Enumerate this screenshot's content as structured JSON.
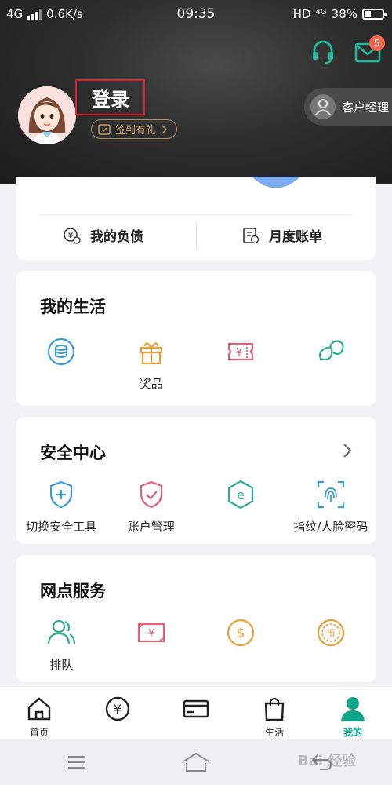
{
  "status_bar": {
    "network": "4G",
    "speed": "0.6K/s",
    "time": "09:35",
    "hd": "HD",
    "network_right": "4G",
    "battery": "38%",
    "battery_level": 0.38
  },
  "header": {
    "message_count": "5",
    "login_label": "登录",
    "signin_label": "签到有礼",
    "manager_label": "客户经理"
  },
  "finance_card": {
    "actions": [
      {
        "label": "我的负债",
        "icon": "debt-icon"
      },
      {
        "label": "月度账单",
        "icon": "bill-icon"
      }
    ]
  },
  "life": {
    "title": "我的生活",
    "items": [
      {
        "label": "",
        "icon": "coins-icon",
        "color": "#3a9bd9"
      },
      {
        "label": "奖品",
        "icon": "gift-icon",
        "color": "#e8a13a"
      },
      {
        "label": "",
        "icon": "ticket-icon",
        "color": "#e0607a"
      },
      {
        "label": "",
        "icon": "beans-icon",
        "color": "#2eae8f"
      }
    ]
  },
  "security": {
    "title": "安全中心",
    "items": [
      {
        "label": "切换安全工具",
        "icon": "shield-plus-icon",
        "color": "#3a9bd9"
      },
      {
        "label": "账户管理",
        "icon": "shield-check-icon",
        "color": "#e0607a"
      },
      {
        "label": "",
        "icon": "e-hexagon-icon",
        "color": "#2eae8f"
      },
      {
        "label": "指纹/人脸密码",
        "icon": "fingerprint-icon",
        "color": "#3a9bd9"
      }
    ]
  },
  "branch": {
    "title": "网点服务",
    "items": [
      {
        "label": "排队",
        "icon": "queue-icon",
        "color": "#2eae8f"
      },
      {
        "label": "",
        "icon": "cash-icon",
        "color": "#e0607a"
      },
      {
        "label": "",
        "icon": "coin-dollar-icon",
        "color": "#e8a13a"
      },
      {
        "label": "",
        "icon": "coin-bi-icon",
        "color": "#e8a13a"
      }
    ]
  },
  "tabs": [
    {
      "label": "首页",
      "icon": "home-icon"
    },
    {
      "label": "",
      "icon": "yen-icon"
    },
    {
      "label": "",
      "icon": "card-icon"
    },
    {
      "label": "生活",
      "icon": "shopping-bag-icon"
    },
    {
      "label": "我的",
      "icon": "person-icon",
      "active": true
    }
  ],
  "colors": {
    "accent": "#10a589",
    "login_highlight": "#e0212a",
    "badge": "#f06a50",
    "signin_gold": "#c8a26a"
  },
  "watermark": "Bai 经验"
}
